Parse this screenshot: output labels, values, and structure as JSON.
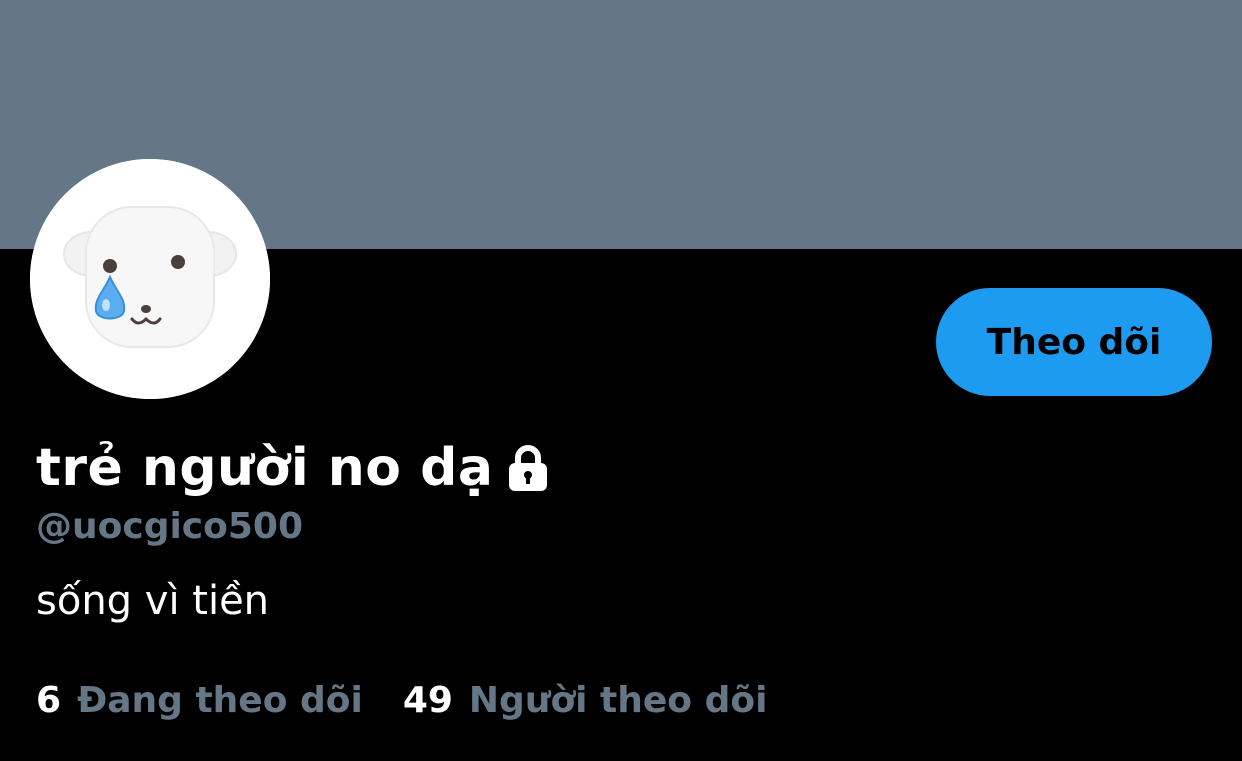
{
  "colors": {
    "banner": "#657786",
    "background": "#000000",
    "accent": "#1d9bf0",
    "muted_text": "#657786",
    "primary_text": "#ffffff"
  },
  "profile": {
    "avatar_icon": "crying-white-dog-icon",
    "display_name": "trẻ người no dạ",
    "protected_icon": "lock-icon",
    "handle": "@uocgico500",
    "bio": "sống vì tiền"
  },
  "actions": {
    "follow_label": "Theo dõi"
  },
  "stats": {
    "following_count": "6",
    "following_label": "Đang theo dõi",
    "followers_count": "49",
    "followers_label": "Người theo dõi"
  }
}
